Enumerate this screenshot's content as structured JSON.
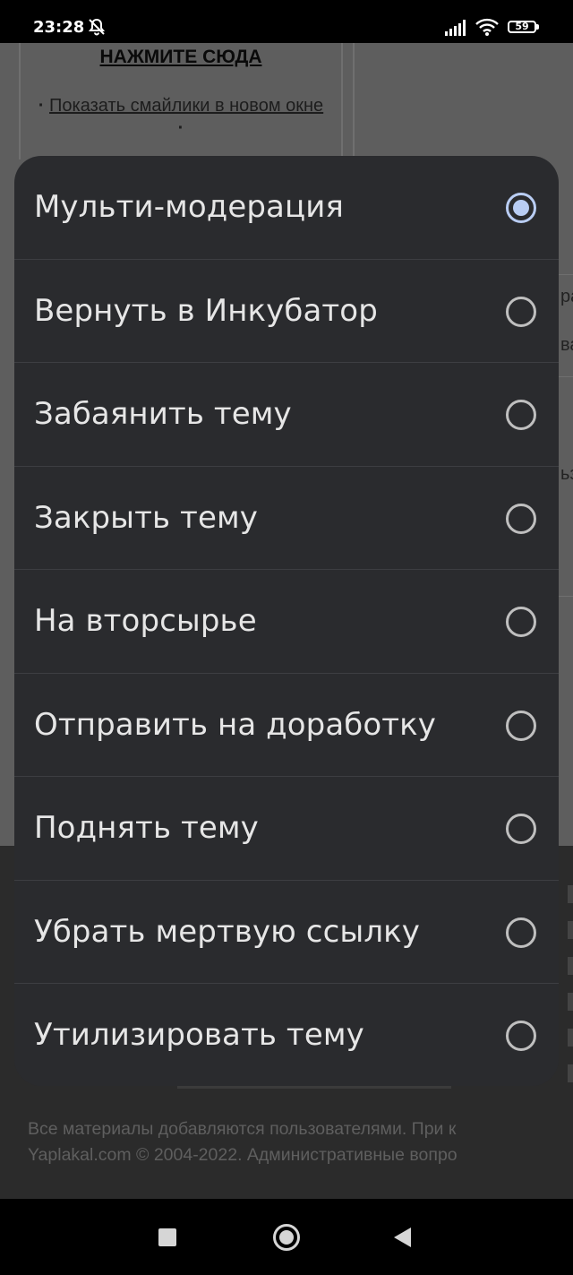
{
  "status_bar": {
    "time": "23:28",
    "battery": "59",
    "icons": [
      "notifications-off-icon",
      "signal-icon",
      "wifi-icon",
      "battery-icon"
    ]
  },
  "background_page": {
    "click_here": "НАЖМИТЕ СЮДА",
    "smiles_prefix": "· ",
    "smiles_link": "Показать смайлики в новом окне",
    "smiles_suffix": " ·",
    "side_fragments": [
      "ра",
      "ва",
      "ьз"
    ],
    "footer_line1": "Все материалы добавляются пользователями. При к",
    "footer_line2": "Yaplakal.com © 2004-2022. Административные вопро"
  },
  "dialog": {
    "selected_index": 0,
    "options": [
      {
        "label": "Мульти-модерация",
        "checked": true
      },
      {
        "label": "Вернуть в Инкубатор",
        "checked": false
      },
      {
        "label": "Забаянить тему",
        "checked": false
      },
      {
        "label": "Закрыть тему",
        "checked": false
      },
      {
        "label": "На вторсырье",
        "checked": false
      },
      {
        "label": "Отправить на доработку",
        "checked": false
      },
      {
        "label": "Поднять тему",
        "checked": false
      },
      {
        "label": "Убрать мертвую ссылку",
        "checked": false
      },
      {
        "label": "Утилизировать тему",
        "checked": false
      }
    ],
    "accent_color": "#b9cdf3"
  },
  "nav_bar": {
    "buttons": [
      "recents-button",
      "home-button",
      "back-button"
    ]
  }
}
